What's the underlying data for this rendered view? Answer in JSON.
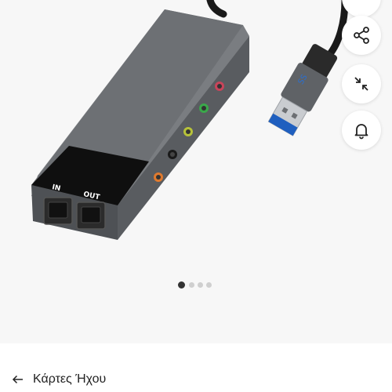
{
  "gallery": {
    "product_image_alt": "USB sound card with optical IN / OUT ports",
    "device_labels": {
      "in": "IN",
      "out": "OUT"
    },
    "dots": {
      "count": 4,
      "active_index": 0
    },
    "actions": [
      "share-icon",
      "collapse-icon",
      "bell-icon"
    ]
  },
  "nav": {
    "back_label": "Κάρτες Ήχου"
  },
  "colors": {
    "background": "#f7f7f7",
    "device_body": "#6a6d71",
    "usb_blue": "#1f5fbf",
    "text": "#222222"
  }
}
